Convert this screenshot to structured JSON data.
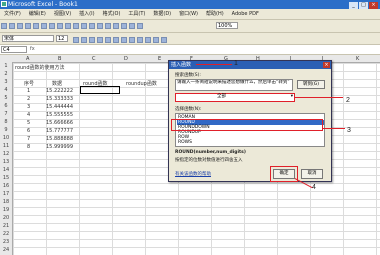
{
  "window": {
    "title": "Microsoft Excel - Book1"
  },
  "menus": [
    "文件(F)",
    "编辑(E)",
    "视图(V)",
    "插入(I)",
    "格式(O)",
    "工具(T)",
    "数据(D)",
    "窗口(W)",
    "帮助(H)",
    "Adobe PDF"
  ],
  "toolbar": {
    "zoom": "100%"
  },
  "format": {
    "font": "宋体",
    "size": "12"
  },
  "formula": {
    "name_box": "C4",
    "fx": "fx"
  },
  "sheet": {
    "col_headers": [
      "A",
      "B",
      "C",
      "D",
      "E",
      "F",
      "G",
      "H",
      "I",
      "J",
      "K"
    ],
    "row_numbers": [
      "1",
      "2",
      "3",
      "4",
      "5",
      "6",
      "7",
      "8",
      "9",
      "10",
      "11",
      "12",
      "13",
      "14",
      "15",
      "16",
      "17",
      "18",
      "19",
      "20",
      "21",
      "22",
      "23",
      "24"
    ],
    "title_cell": "round函数的使用方法",
    "headers": [
      "序号",
      "数据",
      "round函数",
      "roundup函数"
    ],
    "rows": [
      [
        "1",
        "15.222222"
      ],
      [
        "2",
        "15.333333"
      ],
      [
        "3",
        "15.444444"
      ],
      [
        "4",
        "15.555555"
      ],
      [
        "5",
        "15.666666"
      ],
      [
        "6",
        "15.777777"
      ],
      [
        "7",
        "15.888888"
      ],
      [
        "8",
        "15.999999"
      ]
    ]
  },
  "dialog": {
    "title": "插入函数",
    "search_label": "搜索函数(S):",
    "search_text": "请输入一条简短说明来描述您想做什么，然后单击“转到”",
    "go_button": "转到(G)",
    "category_label": "或选择类别(C):",
    "category_value": "全部",
    "list_label": "选择函数(N):",
    "functions": [
      "ROMAN",
      "ROUND",
      "ROUNDDOWN",
      "ROUNDUP",
      "ROW",
      "ROWS",
      "RSQ"
    ],
    "selected_function": "ROUND",
    "signature": "ROUND(number,num_digits)",
    "description": "按指定的位数对数值进行四舍五入",
    "help_link": "有关该函数的帮助",
    "ok_button": "确定",
    "cancel_button": "取消"
  },
  "annotations": {
    "n1": "1",
    "n2": "2",
    "n3": "3",
    "n4": "4"
  },
  "colors": {
    "annotation": "#e0202a",
    "selection": "#3169c6",
    "title_bar": "#2b6ec8"
  }
}
